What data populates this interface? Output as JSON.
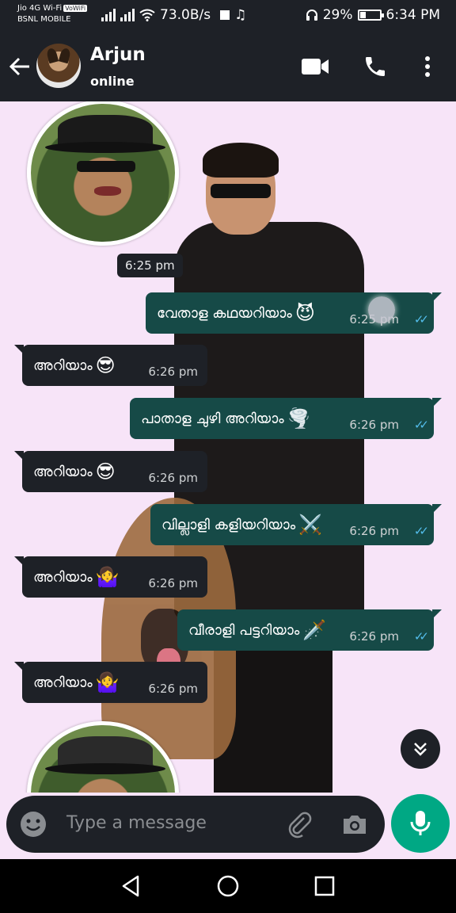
{
  "status_bar": {
    "carrier_line1": "Jio 4G Wi-Fi",
    "vowifi_badge": "VoWiFi",
    "carrier_line2": "BSNL MOBILE",
    "net_speed": "73.0B/s",
    "battery_percent": "29%",
    "time": "6:34 PM",
    "battery_level": 0.29
  },
  "header": {
    "contact_name": "Arjun",
    "contact_status": "online"
  },
  "messages": [
    {
      "type": "sticker",
      "time": "6:25 pm"
    },
    {
      "type": "out",
      "text": "വേതാള കഥയറിയാം",
      "emoji": "😈",
      "time": "6:25 pm",
      "status": "read"
    },
    {
      "type": "in",
      "text": "അറിയാം",
      "emoji": "😎",
      "time": "6:26 pm"
    },
    {
      "type": "out",
      "text": "പാതാള ചുഴി അറിയാം",
      "emoji": "🌪️",
      "time": "6:26 pm",
      "status": "read"
    },
    {
      "type": "in",
      "text": "അറിയാം",
      "emoji": "😎",
      "time": "6:26 pm"
    },
    {
      "type": "out",
      "text": "വില്ലാളി കളിയറിയാം",
      "emoji": "⚔️",
      "time": "6:26 pm",
      "status": "read"
    },
    {
      "type": "in",
      "text": "അറിയാം",
      "emoji": "🤷‍♀️",
      "time": "6:26 pm"
    },
    {
      "type": "out",
      "text": "വീരാളി പട്ടറിയാം",
      "emoji": "🗡️",
      "time": "6:26 pm",
      "status": "read"
    },
    {
      "type": "in",
      "text": "അറിയാം",
      "emoji": "🤷‍♀️",
      "time": "6:26 pm"
    }
  ],
  "composer": {
    "placeholder": "Type a message"
  },
  "colors": {
    "header_bg": "#1e2127",
    "outgoing_bubble": "#164a47",
    "incoming_bubble": "#1e2127",
    "mic_button": "#00a884",
    "read_ticks": "#53bdeb",
    "chat_wallpaper": "#f7e4f8"
  },
  "icons": {
    "back": "arrow-left-icon",
    "video": "video-camera-icon",
    "phone": "phone-icon",
    "menu": "vertical-dots-icon",
    "scroll": "double-chevron-down-icon",
    "emoji": "smiley-icon",
    "attach": "paperclip-icon",
    "camera": "camera-icon",
    "mic": "microphone-icon",
    "nav_back": "triangle-back-icon",
    "nav_home": "circle-home-icon",
    "nav_recent": "square-recents-icon"
  }
}
